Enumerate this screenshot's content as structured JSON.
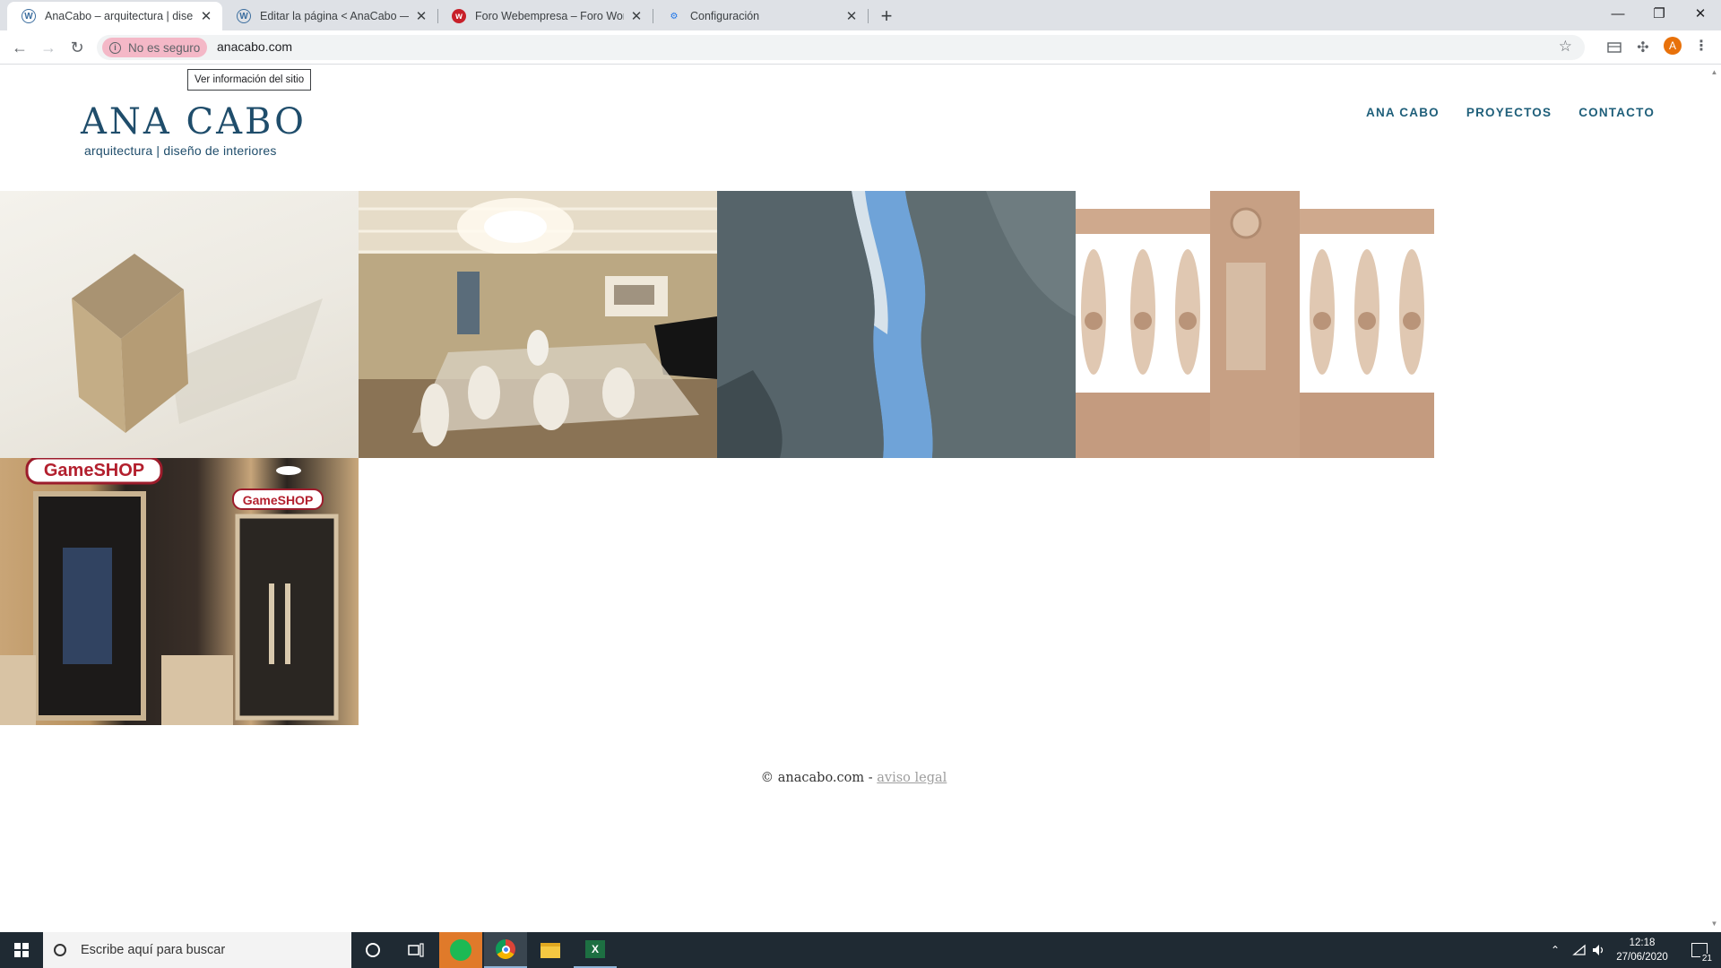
{
  "browser": {
    "tabs": [
      {
        "title": "AnaCabo – arquitectura | diseño",
        "favicon": "wordpress-icon",
        "active": true
      },
      {
        "title": "Editar la página < AnaCabo — W",
        "favicon": "wordpress-icon",
        "active": false
      },
      {
        "title": "Foro Webempresa – Foro WordP",
        "favicon": "webempresa-icon",
        "active": false
      },
      {
        "title": "Configuración",
        "favicon": "gear-icon",
        "active": false
      }
    ],
    "security_chip": "No es seguro",
    "url": "anacabo.com",
    "tooltip": "Ver información del sitio",
    "profile_initial": "A",
    "icons": {
      "wp_glyph": "W",
      "we_glyph": "w",
      "gear_glyph": "⚙",
      "close_glyph": "✕",
      "newtab_glyph": "+",
      "minimize_glyph": "—",
      "restore_glyph": "❐",
      "window_close_glyph": "✕",
      "back_glyph": "←",
      "forward_glyph": "→",
      "reload_glyph": "↻",
      "info_glyph": "i",
      "star_glyph": "☆",
      "puzzle_glyph": "✣",
      "kebab_glyph": "⋮"
    }
  },
  "site": {
    "logo_main": "ANA CABO",
    "logo_sub": "arquitectura | diseño de interiores",
    "nav": [
      "ANA CABO",
      "PROYECTOS",
      "CONTACTO"
    ],
    "gallery": [
      {
        "name": "wooden-cube-render"
      },
      {
        "name": "interior-living-room-render"
      },
      {
        "name": "curved-walls-render"
      },
      {
        "name": "stone-balustrade-photo"
      },
      {
        "name": "gameshop-storefront-photo",
        "sign_text": "GameSHOP"
      }
    ],
    "footer_text": "© anacabo.com - ",
    "footer_link": "aviso legal",
    "accent_color": "#1f5f7a"
  },
  "taskbar": {
    "search_placeholder": "Escribe aquí para buscar",
    "time": "12:18",
    "date": "27/06/2020",
    "notifications": "21"
  }
}
